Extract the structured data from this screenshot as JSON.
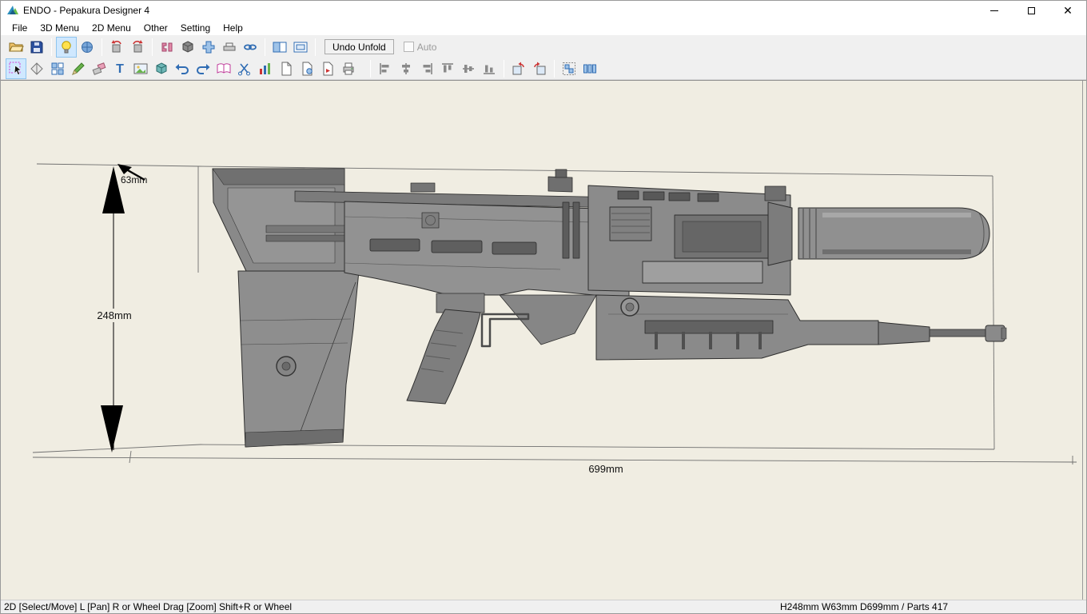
{
  "window": {
    "title": "ENDO - Pepakura Designer 4"
  },
  "menu": {
    "items": [
      "File",
      "3D Menu",
      "2D Menu",
      "Other",
      "Setting",
      "Help"
    ]
  },
  "toolbar1": {
    "undo_unfold_label": "Undo Unfold",
    "auto_label": "Auto",
    "icons": [
      "open-file",
      "save",
      "toggle-light",
      "texture-view",
      "rotate-model-left",
      "rotate-model-right",
      "edit-joints",
      "solid-view",
      "unfold",
      "flatten-view",
      "sync-views",
      "two-pane-layout",
      "single-pane-layout"
    ]
  },
  "toolbar2": {
    "icons": [
      "select-move",
      "divide-part",
      "check-parts",
      "draw-line",
      "eraser",
      "text-tool",
      "insert-image",
      "material-view",
      "undo",
      "redo",
      "open-spread",
      "cut-parts",
      "statistics",
      "new-page",
      "page-setup",
      "refresh-page",
      "print",
      "align-left",
      "align-center",
      "align-right",
      "align-top",
      "align-middle",
      "align-bottom",
      "rotate-ccw",
      "rotate-cw",
      "arrange-parts",
      "distribute-parts"
    ]
  },
  "canvas": {
    "height_label": "248mm",
    "depth_label": "63mm",
    "width_label": "699mm"
  },
  "statusbar": {
    "left": "2D [Select/Move] L [Pan] R or Wheel Drag [Zoom] Shift+R or Wheel",
    "right": "H248mm W63mm D699mm / Parts 417"
  }
}
